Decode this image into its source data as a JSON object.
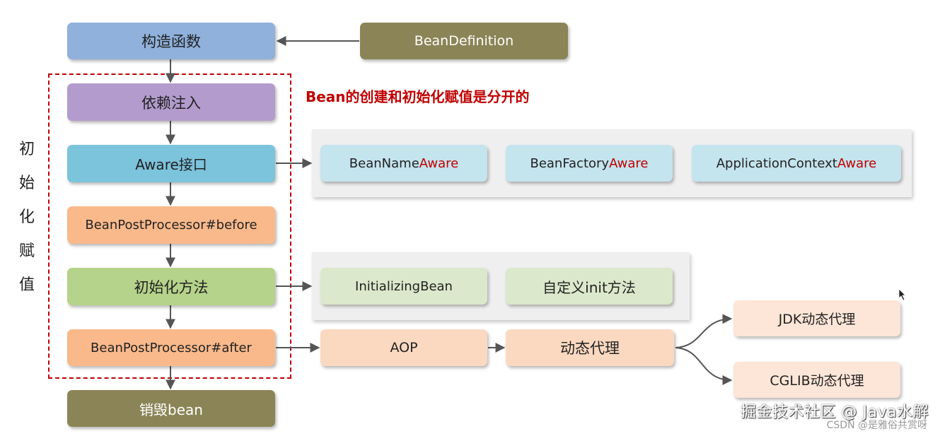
{
  "flow": {
    "constructor": "构造函数",
    "bean_definition": "BeanDefinition",
    "di": "依赖注入",
    "aware": "Aware接口",
    "bpp_before": "BeanPostProcessor#before",
    "init_method": "初始化方法",
    "bpp_after": "BeanPostProcessor#after",
    "destroy": "销毁bean"
  },
  "side_label": [
    "初",
    "始",
    "化",
    "赋",
    "值"
  ],
  "note": "Bean的创建和初始化赋值是分开的",
  "aware_items": [
    {
      "prefix": "BeanName",
      "suffix": "Aware"
    },
    {
      "prefix": "BeanFactory",
      "suffix": "Aware"
    },
    {
      "prefix": "ApplicationContext",
      "suffix": "Aware"
    }
  ],
  "init_items": [
    "InitializingBean",
    "自定义init方法"
  ],
  "aop": {
    "aop": "AOP",
    "dynamic_proxy": "动态代理",
    "jdk": "JDK动态代理",
    "cglib": "CGLIB动态代理"
  },
  "watermark": {
    "main": "掘金技术社区 @ Java水解",
    "sub": "CSDN @是雅俗共赏呀"
  },
  "colors": {
    "blue": "#8fb1dc",
    "olive": "#8b8456",
    "purple": "#b39bcd",
    "cyan": "#7cc3dc",
    "orange": "#f9b98b",
    "green": "#b5d38a",
    "light_cyan": "#c4e4ee",
    "light_green": "#dbe8cb",
    "peach": "#fbd9c0",
    "light_peach": "#fde6d7",
    "accent_red": "#c00000"
  }
}
